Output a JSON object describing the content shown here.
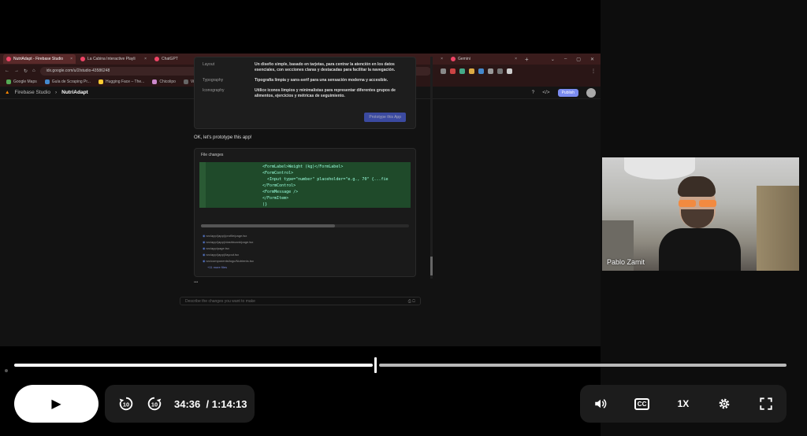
{
  "browser": {
    "tabs": [
      {
        "label": "NutriAdapt - Firebase Studio",
        "active": true
      },
      {
        "label": "La Cabina Interactive Playli",
        "active": false
      },
      {
        "label": "ChatGPT",
        "active": false
      },
      {
        "label": "Grok / X",
        "active": false
      },
      {
        "label": "DeepSeek - Into the Unknown",
        "active": false
      },
      {
        "label": "Claude",
        "active": false
      },
      {
        "label": "Gemini",
        "active": false
      }
    ],
    "new_tab": "+",
    "url": "idx.google.com/u/2/studio-43586248",
    "bookmarks": [
      "Google Maps",
      "Guía de Scraping Pr...",
      "Hugging Face – The...",
      "Chicolipo",
      "Viu",
      "Útiles",
      "Vital Leads",
      "Airtable"
    ]
  },
  "app": {
    "brand": "Firebase Studio",
    "project": "NutriAdapt",
    "publish_label": "Publish"
  },
  "plan": {
    "rows": [
      {
        "key": "Layout",
        "value": "Un diseño simple, basado en tarjetas, para centrar la atención en los datos esenciales, con secciones claras y destacadas para facilitar la navegación."
      },
      {
        "key": "Typography",
        "value": "Tipografía limpia y sans-serif para una sensación moderna y accesible."
      },
      {
        "key": "Iconography",
        "value": "Utilice iconos limpios y minimalistas para representar diferentes grupos de alimentos, ejercicios y métricas de seguimiento."
      }
    ],
    "prototype_button": "Prototype this App"
  },
  "ok_message": "OK, let's prototype this app!",
  "file_changes": {
    "header": "File changes",
    "code_lines": [
      "<FormLabel>Weight (kg)</FormLabel>",
      "<FormControl>",
      "  <Input type=\"number\" placeholder=\"e.g., 70\" {...fie",
      "</FormControl>",
      "<FormMessage />",
      "</FormItem>",
      ")}"
    ],
    "files": [
      "src/app/(app)/profile/page.tsx",
      "src/app/(app)/dashboard/page.tsx",
      "src/app/page.tsx",
      "src/app/(app)/layout.tsx",
      "src/components/logo/Nutrients.tsx"
    ],
    "more": "+11 more files"
  },
  "prompt_placeholder": "Describe the changes you want to make",
  "webcam": {
    "name": "Pablo Zamit"
  },
  "player": {
    "current_time": "34:36",
    "total_time": "/ 1:14:13",
    "progress": 0.466,
    "speed": "1X",
    "cc": "CC",
    "rewind_label": "10",
    "forward_label": "10"
  }
}
